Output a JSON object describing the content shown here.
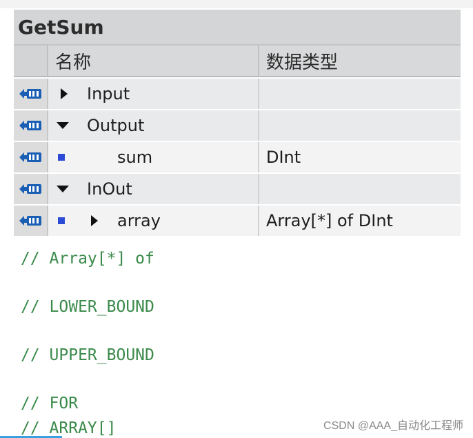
{
  "block": {
    "title": "GetSum"
  },
  "table": {
    "headers": {
      "name": "名称",
      "type": "数据类型"
    },
    "rows": [
      {
        "kind": "section",
        "expander": "collapsed",
        "name": "Input",
        "type": ""
      },
      {
        "kind": "section",
        "expander": "expanded",
        "name": "Output",
        "type": ""
      },
      {
        "kind": "variable",
        "expander": "none",
        "name": "sum",
        "type": "DInt"
      },
      {
        "kind": "section",
        "expander": "expanded",
        "name": "InOut",
        "type": ""
      },
      {
        "kind": "variable",
        "expander": "collapsed",
        "name": "array",
        "type": "Array[*] of DInt"
      }
    ]
  },
  "code": {
    "lines": [
      "// Array[*] of",
      "// LOWER_BOUND",
      "// UPPER_BOUND",
      "// FOR",
      "// ARRAY[]"
    ]
  },
  "watermark": "CSDN @AAA_自动化工程师",
  "colors": {
    "comment_green": "#3a8a4a",
    "icon_blue": "#1a5fb4",
    "var_marker": "#2b4bd6"
  }
}
